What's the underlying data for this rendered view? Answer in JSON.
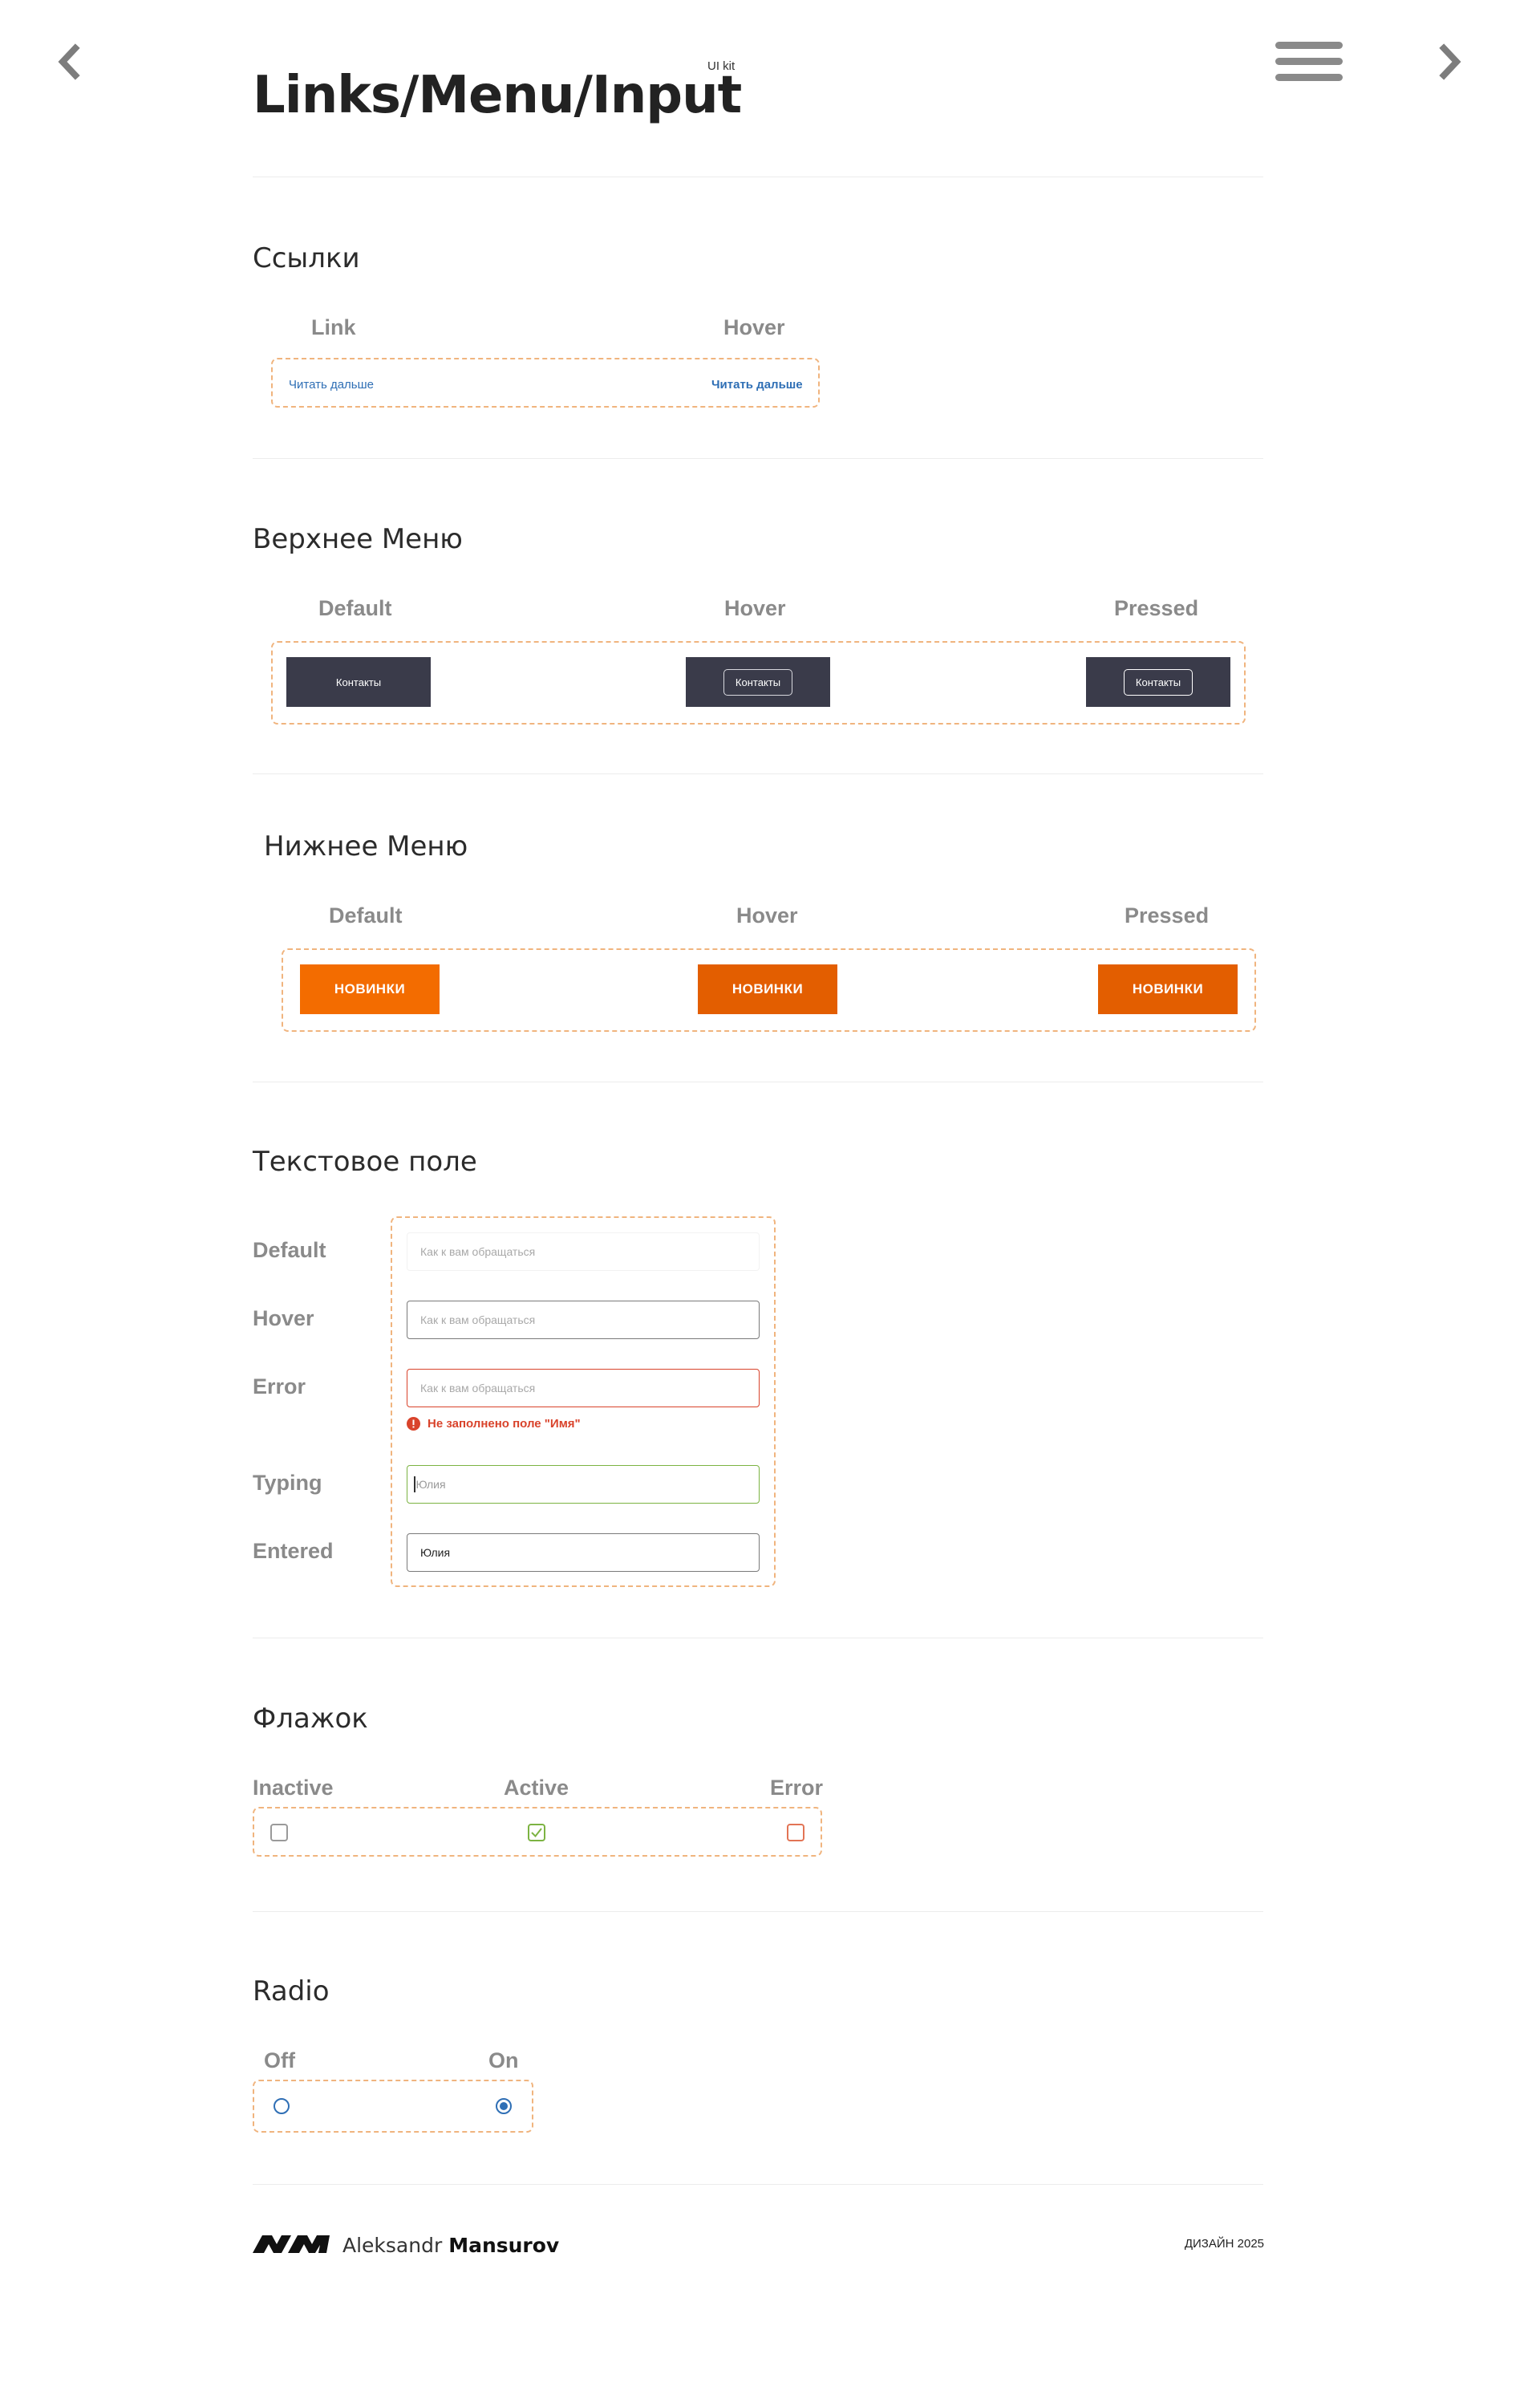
{
  "header": {
    "title": "Links/Menu/Input",
    "badge": "UI kit"
  },
  "colors": {
    "accent_orange": "#f36c00",
    "accent_orange_dark": "#e35e00",
    "dark_navy": "#3a3b4a",
    "link_blue": "#2f6fb5",
    "error_red": "#d9432b",
    "success_green": "#7cb342",
    "dashed_border": "#f0b47e"
  },
  "links_section": {
    "title": "Ссылки",
    "states": [
      "Link",
      "Hover"
    ],
    "link_text": "Читать дальше"
  },
  "top_menu": {
    "title": "Верхнее Меню",
    "states": [
      "Default",
      "Hover",
      "Pressed"
    ],
    "button_label": "Контакты"
  },
  "bottom_menu": {
    "title": "Нижнее Меню",
    "states": [
      "Default",
      "Hover",
      "Pressed"
    ],
    "button_label": "НОВИНКИ"
  },
  "text_field": {
    "title": "Текстовое поле",
    "states": [
      "Default",
      "Hover",
      "Error",
      "Typing",
      "Entered"
    ],
    "placeholder": "Как к вам обращаться",
    "error_message": "Не заполнено поле \"Имя\"",
    "typed_value": "Юлия",
    "entered_value": "Юлия"
  },
  "checkbox_section": {
    "title": "Флажок",
    "states": [
      "Inactive",
      "Active",
      "Error"
    ]
  },
  "radio_section": {
    "title": "Radio",
    "states": [
      "Off",
      "On"
    ]
  },
  "footer": {
    "author_first": "Aleksandr",
    "author_last": "Mansurov",
    "design_year": "ДИЗАЙН 2025"
  },
  "icons": {
    "nav_prev": "chevron-left-icon",
    "nav_next": "chevron-right-icon",
    "menu": "hamburger-menu-icon",
    "error": "exclamation-circle-icon",
    "check": "check-icon",
    "logo": "am-logo-icon"
  }
}
